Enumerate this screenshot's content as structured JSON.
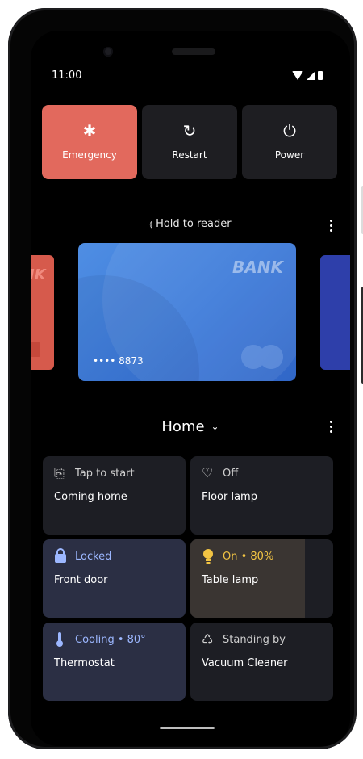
{
  "status_bar": {
    "time": "11:00"
  },
  "power_menu": [
    {
      "label": "Emergency",
      "icon": "asterisk-icon",
      "glyph": "✱"
    },
    {
      "label": "Restart",
      "icon": "restart-icon",
      "glyph": "↻"
    },
    {
      "label": "Power",
      "icon": "power-icon",
      "glyph": "⏻"
    }
  ],
  "wallet": {
    "hold_label": "Hold to reader",
    "card": {
      "bank_name": "BANK",
      "number": "•••• 8873"
    },
    "left_card_text": "IK"
  },
  "home": {
    "title": "Home",
    "tiles": [
      {
        "status": "Tap to start",
        "name": "Coming home",
        "icon": "routine-icon",
        "glyph": "⎘"
      },
      {
        "status": "Off",
        "name": "Floor lamp",
        "icon": "lightbulb-icon",
        "glyph": "♡"
      },
      {
        "status": "Locked",
        "name": "Front door",
        "icon": "lock-icon",
        "glyph": "🔒"
      },
      {
        "status": "On • 80%",
        "name": "Table lamp",
        "icon": "lightbulb-on-icon",
        "glyph": "●",
        "level": 0.8
      },
      {
        "status": "Cooling • 80°",
        "name": "Thermostat",
        "icon": "thermometer-icon",
        "glyph": "🌡"
      },
      {
        "status": "Standing by",
        "name": "Vacuum Cleaner",
        "icon": "vacuum-icon",
        "glyph": "♺"
      }
    ]
  },
  "colors": {
    "emergency": "#e2695d",
    "tile_bg": "#1d1e24",
    "tile_active_blue": "#9cb7ff",
    "lamp_on": "#f2c443",
    "card_blue": "#3b79d9"
  }
}
